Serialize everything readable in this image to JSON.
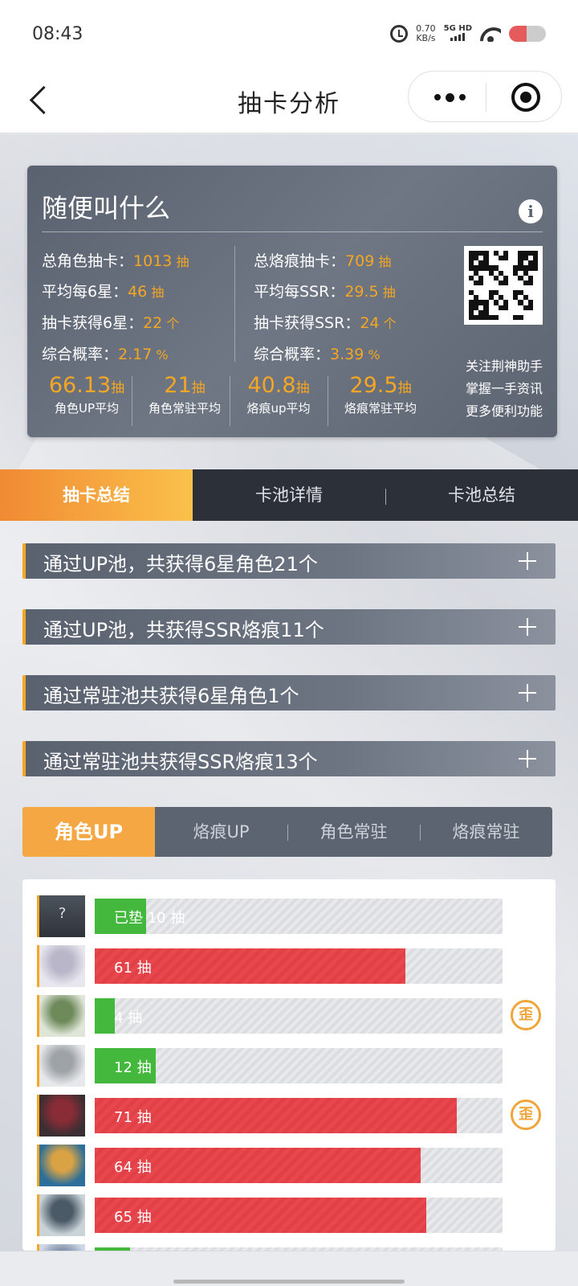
{
  "status": {
    "time": "08:43",
    "speed": "0.70",
    "speed_unit": "KB/s",
    "network": "5G HD"
  },
  "nav": {
    "title": "抽卡分析"
  },
  "card": {
    "name": "随便叫什么",
    "left_stats": [
      {
        "label": "总角色抽卡：",
        "value": "1013",
        "unit": " 抽"
      },
      {
        "label": "平均每6星：",
        "value": "46",
        "unit": " 抽"
      },
      {
        "label": "抽卡获得6星：",
        "value": "22",
        "unit": " 个"
      },
      {
        "label": "综合概率：",
        "value": "2.17",
        "unit": " %"
      }
    ],
    "right_stats": [
      {
        "label": "总烙痕抽卡：",
        "value": "709",
        "unit": " 抽"
      },
      {
        "label": "平均每SSR：",
        "value": "29.5",
        "unit": " 抽"
      },
      {
        "label": "抽卡获得SSR：",
        "value": "24",
        "unit": " 个"
      },
      {
        "label": "综合概率：",
        "value": "3.39",
        "unit": " %"
      }
    ],
    "averages": [
      {
        "value": "66.13",
        "unit": "抽",
        "label": "角色UP平均"
      },
      {
        "value": "21",
        "unit": "抽",
        "label": "角色常驻平均"
      },
      {
        "value": "40.8",
        "unit": "抽",
        "label": "烙痕up平均"
      },
      {
        "value": "29.5",
        "unit": "抽",
        "label": "烙痕常驻平均"
      }
    ],
    "promo": [
      "关注荆神助手",
      "掌握一手资讯",
      "更多便利功能"
    ]
  },
  "main_tabs": [
    "抽卡总结",
    "卡池详情",
    "卡池总结"
  ],
  "accordions": [
    "通过UP池，共获得6星角色21个",
    "通过UP池，共获得SSR烙痕11个",
    "通过常驻池共获得6星角色1个",
    "通过常驻池共获得SSR烙痕13个"
  ],
  "sub_tabs": [
    "角色UP",
    "烙痕UP",
    "角色常驻",
    "烙痕常驻"
  ],
  "history": [
    {
      "label": "已垫 10 抽",
      "pulls": 10,
      "color": "green",
      "off_banner": false,
      "unknown": true
    },
    {
      "label": "61 抽",
      "pulls": 61,
      "color": "red",
      "off_banner": false
    },
    {
      "label": "4 抽",
      "pulls": 4,
      "color": "green",
      "off_banner": true
    },
    {
      "label": "12 抽",
      "pulls": 12,
      "color": "green",
      "off_banner": false
    },
    {
      "label": "71 抽",
      "pulls": 71,
      "color": "red",
      "off_banner": true
    },
    {
      "label": "64 抽",
      "pulls": 64,
      "color": "red",
      "off_banner": false
    },
    {
      "label": "65 抽",
      "pulls": 65,
      "color": "red",
      "off_banner": false
    },
    {
      "label": "",
      "pulls": 7,
      "color": "green",
      "off_banner": false
    }
  ],
  "off_banner_badge": "歪",
  "unknown_avatar": "?",
  "max_pulls": 80
}
